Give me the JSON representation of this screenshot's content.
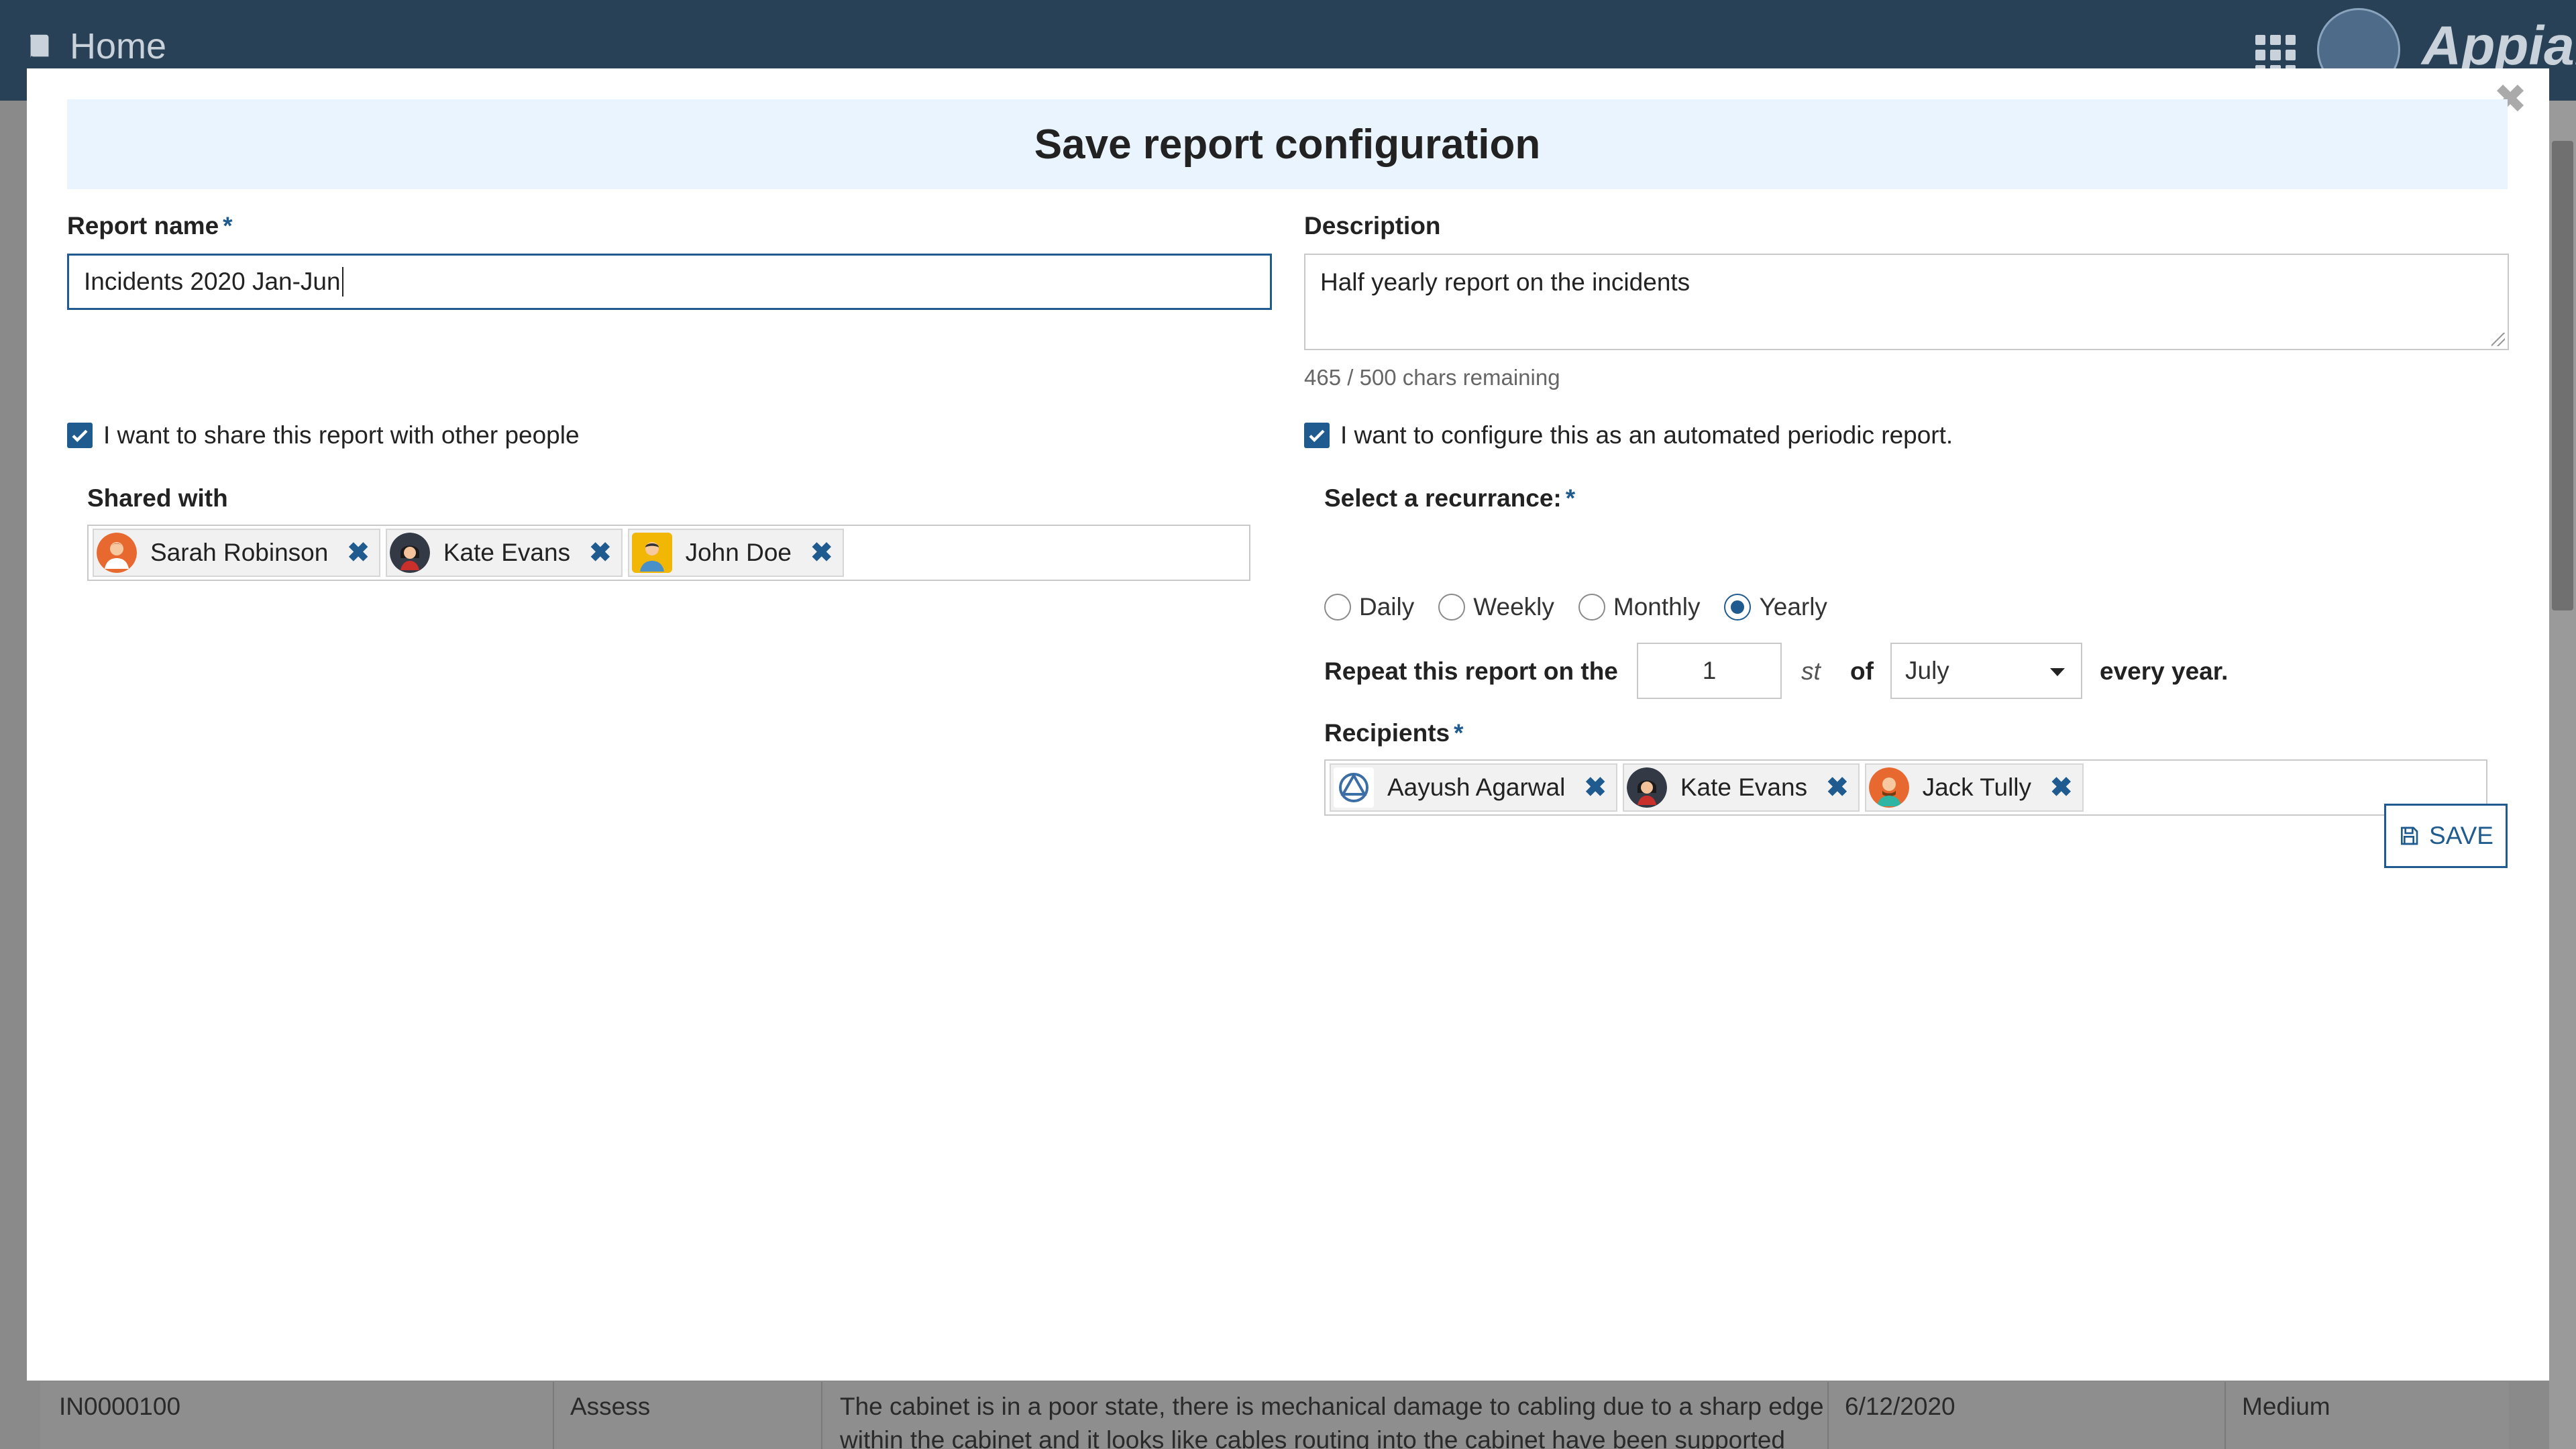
{
  "app": {
    "home_label": "Home",
    "brand": "Appian"
  },
  "background_row": {
    "id": "IN0000100",
    "status": "Assess",
    "description_line1": "The cabinet is in a poor state, there is mechanical damage to cabling due to a sharp edge",
    "description_line2": "within the cabinet and it looks like cables routing into the cabinet have been supported",
    "date": "6/12/2020",
    "priority": "Medium"
  },
  "modal": {
    "title": "Save report configuration",
    "close_icon": "close-icon",
    "required_marker": "*",
    "report_name": {
      "label": "Report name",
      "value": "Incidents 2020 Jan-Jun"
    },
    "description": {
      "label": "Description",
      "value": "Half yearly report on the incidents",
      "helper": "465 / 500 chars remaining"
    },
    "share": {
      "checkbox_label": "I want to share this report with other people",
      "checked": true,
      "shared_with_label": "Shared with",
      "people": [
        {
          "name": "Sarah Robinson",
          "avatar": "female-avatar-orange"
        },
        {
          "name": "Kate Evans",
          "avatar": "female-avatar-dark"
        },
        {
          "name": "John Doe",
          "avatar": "male-avatar-yellow"
        }
      ]
    },
    "periodic": {
      "checkbox_label": "I want to configure this as an automated periodic report.",
      "checked": true,
      "recurrence_label": "Select a recurrance:",
      "options": [
        "Daily",
        "Weekly",
        "Monthly",
        "Yearly"
      ],
      "selected": "Yearly",
      "repeat_prefix": "Repeat this report on the",
      "day": "1",
      "ordinal_suffix": "st",
      "of_label": "of",
      "month": "July",
      "repeat_suffix": "every year.",
      "recipients_label": "Recipients",
      "recipients": [
        {
          "name": "Aayush Agarwal",
          "avatar": "appian-logo-avatar"
        },
        {
          "name": "Kate Evans",
          "avatar": "female-avatar-dark"
        },
        {
          "name": "Jack Tully",
          "avatar": "male-avatar-orange"
        }
      ]
    },
    "save_label": "SAVE",
    "remove_glyph": "✖"
  },
  "colors": {
    "accent": "#1f5b8f",
    "header_band": "#eaf4fe",
    "app_bar": "#284157"
  }
}
